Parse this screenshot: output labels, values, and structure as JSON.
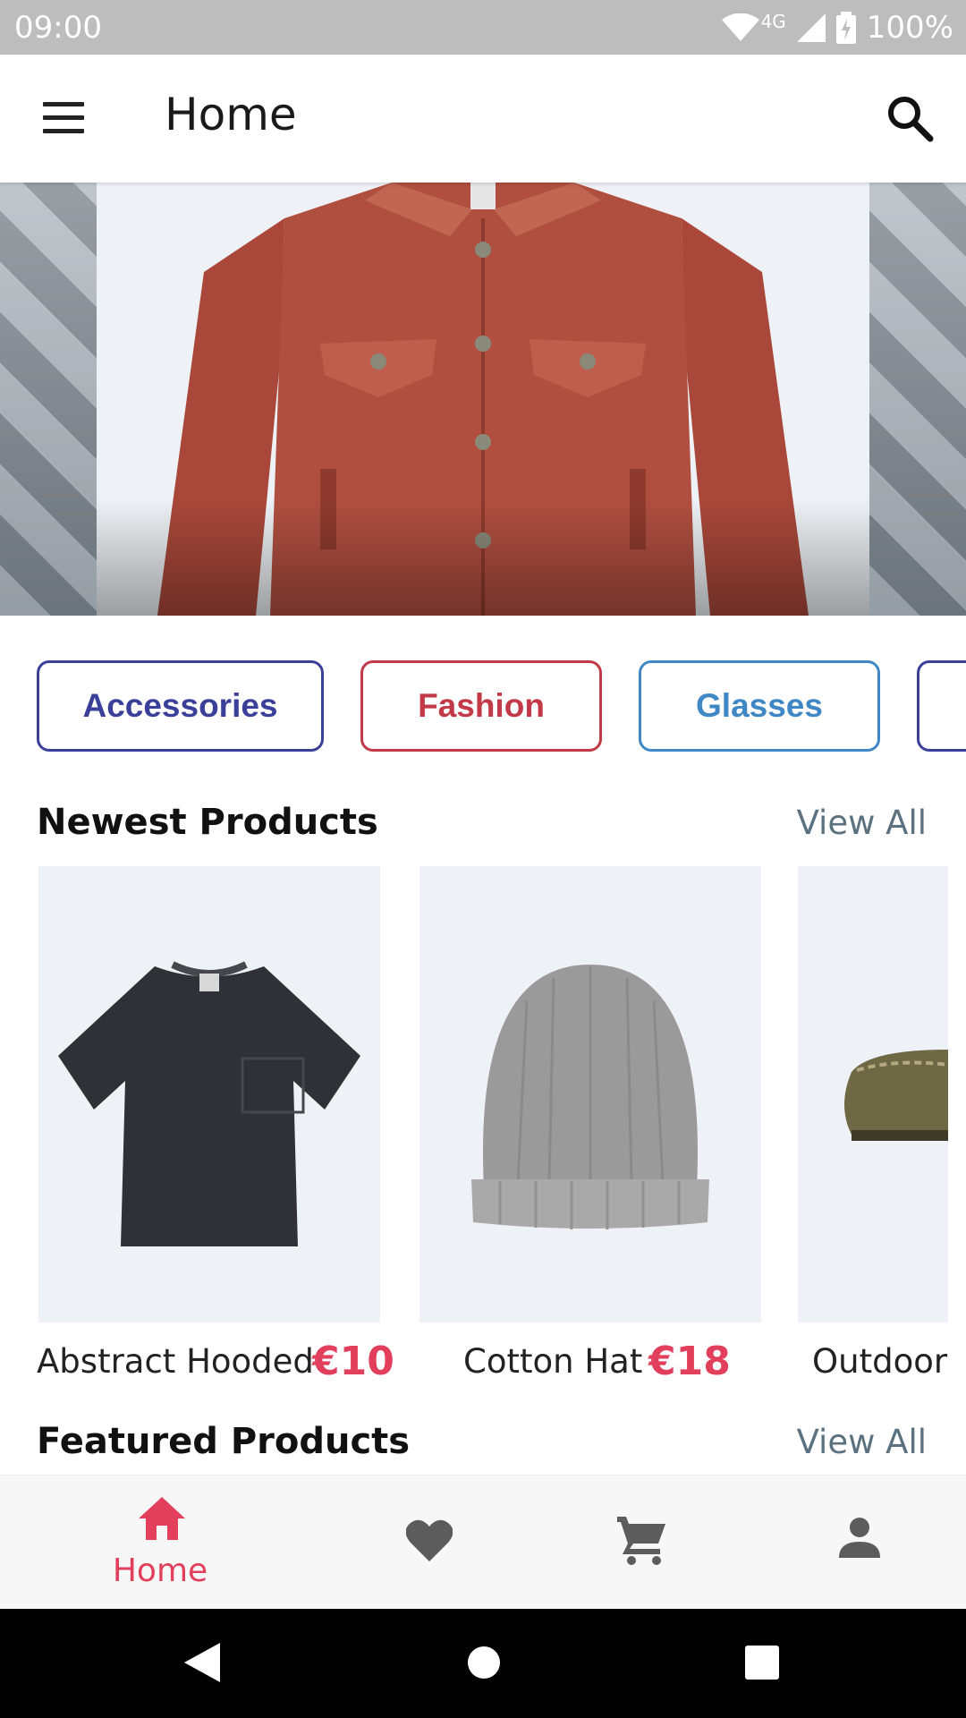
{
  "status": {
    "time": "09:00",
    "network": "4G",
    "battery": "100%"
  },
  "appbar": {
    "title": "Home",
    "menu_icon": "menu-icon",
    "search_icon": "search-icon"
  },
  "banner": {
    "image": "red denim jacket"
  },
  "categories": [
    {
      "label": "Accessories",
      "color": "#3a3f9a"
    },
    {
      "label": "Fashion",
      "color": "#c23a48"
    },
    {
      "label": "Glasses",
      "color": "#3f88c5"
    }
  ],
  "newest": {
    "title": "Newest Products",
    "view_all": "View All",
    "items": [
      {
        "name": "Abstract Hooded",
        "price": "€10",
        "image": "black t-shirt"
      },
      {
        "name": "Cotton Hat",
        "price": "€18",
        "image": "grey beanie"
      },
      {
        "name": "Outdoor",
        "price": "",
        "image": "olive loafer"
      }
    ]
  },
  "featured": {
    "title": "Featured Products",
    "view_all": "View All"
  },
  "bottom_nav": {
    "active_color": "#e23f5c",
    "inactive_color": "#5c5c5c",
    "items": [
      {
        "label": "Home",
        "icon": "home-icon"
      },
      {
        "label": "",
        "icon": "heart-icon"
      },
      {
        "label": "",
        "icon": "cart-icon"
      },
      {
        "label": "",
        "icon": "person-icon"
      }
    ]
  }
}
